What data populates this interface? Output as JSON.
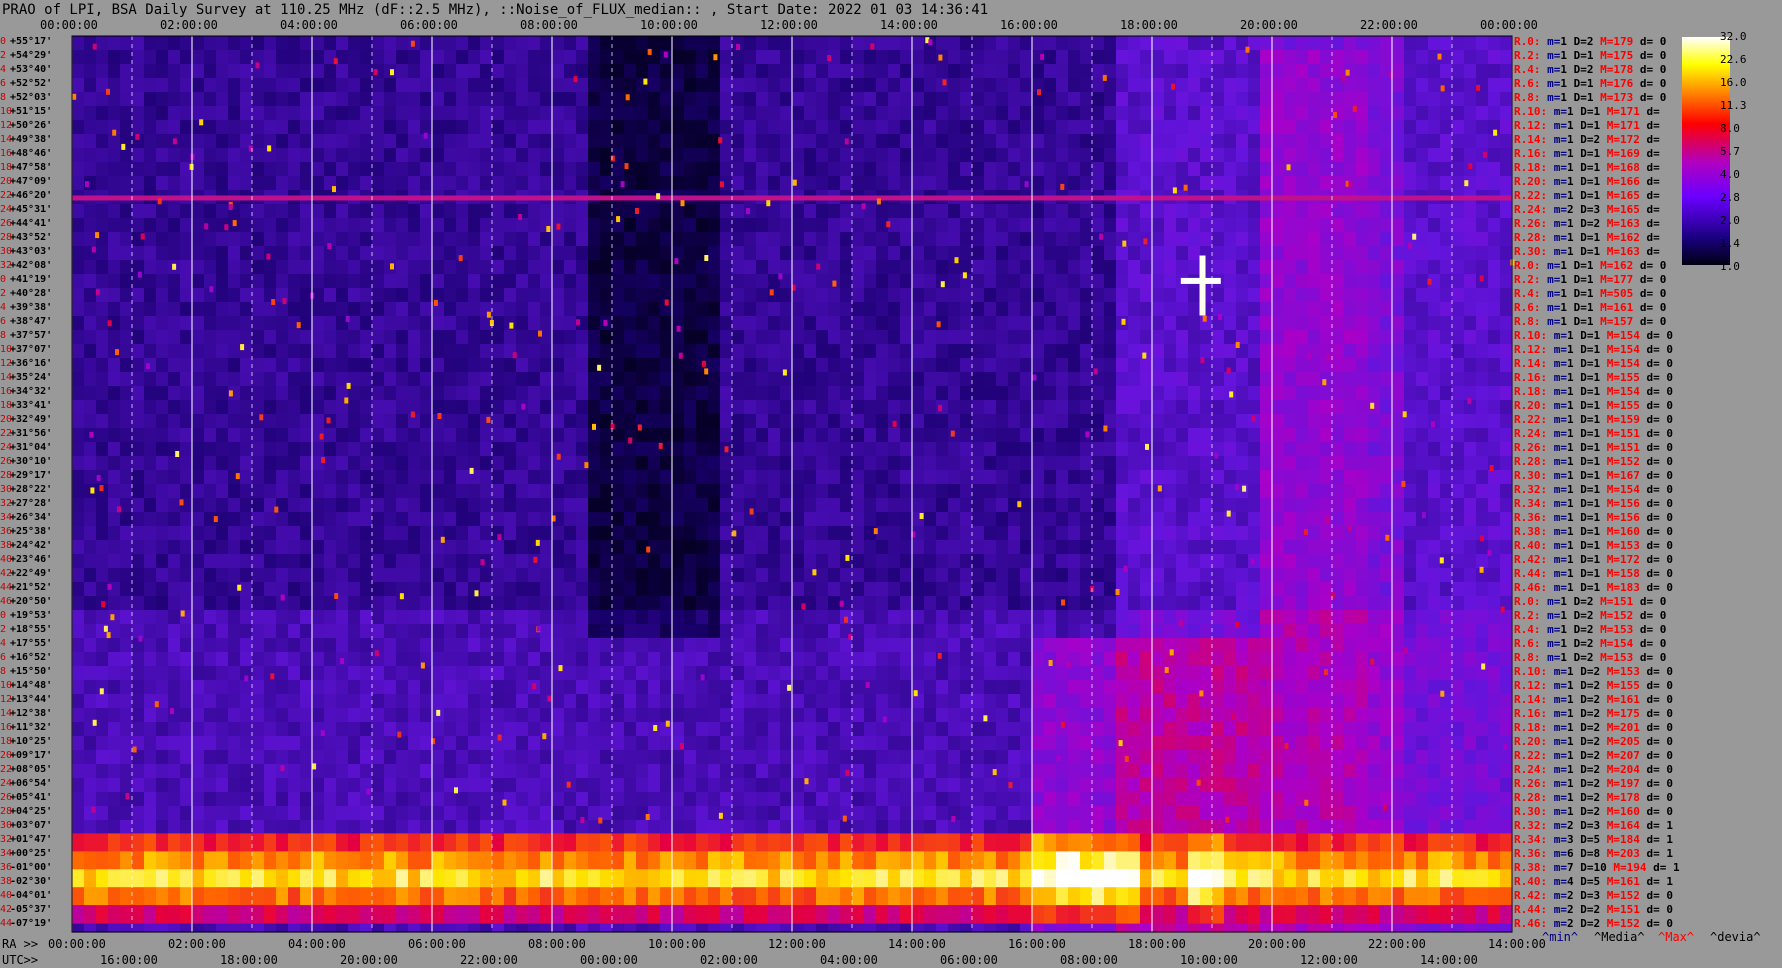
{
  "title": "PRAO of LPI, BSA Daily Survey at 110.25 MHz (dF::2.5 MHz), ::Noise_of_FLUX_median:: , Start Date: 2022 01 03 14:36:41",
  "chart_data": {
    "type": "heatmap",
    "title": "PRAO of LPI, BSA Daily Survey at 110.25 MHz (dF::2.5 MHz), ::Noise_of_FLUX_median:: , Start Date: 2022 01 03 14:36:41",
    "x_top_ticks": [
      "00:00:00",
      "02:00:00",
      "04:00:00",
      "06:00:00",
      "08:00:00",
      "10:00:00",
      "12:00:00",
      "14:00:00",
      "16:00:00",
      "18:00:00",
      "20:00:00",
      "22:00:00",
      "00:00:00"
    ],
    "x_bottom_ra_prefix": "RA >>",
    "x_bottom_ra_ticks": [
      "00:00:00",
      "02:00:00",
      "04:00:00",
      "06:00:00",
      "08:00:00",
      "10:00:00",
      "12:00:00",
      "14:00:00",
      "16:00:00",
      "18:00:00",
      "20:00:00",
      "22:00:00",
      "14:00:00"
    ],
    "x_bottom_utc_prefix": "UTC>>",
    "x_bottom_utc_ticks": [
      "16:00:00",
      "18:00:00",
      "20:00:00",
      "22:00:00",
      "00:00:00",
      "02:00:00",
      "04:00:00",
      "06:00:00",
      "08:00:00",
      "10:00:00",
      "12:00:00",
      "14:00:00"
    ],
    "y_labels": [
      {
        "i": "0",
        "d": "+55°17'"
      },
      {
        "i": "2",
        "d": "+54°29'"
      },
      {
        "i": "4",
        "d": "+53°40'"
      },
      {
        "i": "6",
        "d": "+52°52'"
      },
      {
        "i": "8",
        "d": "+52°03'"
      },
      {
        "i": "10",
        "d": "+51°15'"
      },
      {
        "i": "12",
        "d": "+50°26'"
      },
      {
        "i": "14",
        "d": "+49°38'"
      },
      {
        "i": "16",
        "d": "+48°46'"
      },
      {
        "i": "18",
        "d": "+47°58'"
      },
      {
        "i": "20",
        "d": "+47°09'"
      },
      {
        "i": "22",
        "d": "+46°20'"
      },
      {
        "i": "24",
        "d": "+45°31'"
      },
      {
        "i": "26",
        "d": "+44°41'"
      },
      {
        "i": "28",
        "d": "+43°52'"
      },
      {
        "i": "30",
        "d": "+43°03'"
      },
      {
        "i": "32",
        "d": "+42°08'"
      },
      {
        "i": "0",
        "d": "+41°19'"
      },
      {
        "i": "2",
        "d": "+40°28'"
      },
      {
        "i": "4",
        "d": "+39°38'"
      },
      {
        "i": "6",
        "d": "+38°47'"
      },
      {
        "i": "8",
        "d": "+37°57'"
      },
      {
        "i": "10",
        "d": "+37°07'"
      },
      {
        "i": "12",
        "d": "+36°16'"
      },
      {
        "i": "14",
        "d": "+35°24'"
      },
      {
        "i": "16",
        "d": "+34°32'"
      },
      {
        "i": "18",
        "d": "+33°41'"
      },
      {
        "i": "20",
        "d": "+32°49'"
      },
      {
        "i": "22",
        "d": "+31°56'"
      },
      {
        "i": "24",
        "d": "+31°04'"
      },
      {
        "i": "26",
        "d": "+30°10'"
      },
      {
        "i": "28",
        "d": "+29°17'"
      },
      {
        "i": "30",
        "d": "+28°22'"
      },
      {
        "i": "32",
        "d": "+27°28'"
      },
      {
        "i": "34",
        "d": "+26°34'"
      },
      {
        "i": "36",
        "d": "+25°38'"
      },
      {
        "i": "38",
        "d": "+24°42'"
      },
      {
        "i": "40",
        "d": "+23°46'"
      },
      {
        "i": "42",
        "d": "+22°49'"
      },
      {
        "i": "44",
        "d": "+21°52'"
      },
      {
        "i": "46",
        "d": "+20°50'"
      },
      {
        "i": "0",
        "d": "+19°53'"
      },
      {
        "i": "2",
        "d": "+18°55'"
      },
      {
        "i": "4",
        "d": "+17°55'"
      },
      {
        "i": "6",
        "d": "+16°52'"
      },
      {
        "i": "8",
        "d": "+15°50'"
      },
      {
        "i": "10",
        "d": "+14°48'"
      },
      {
        "i": "12",
        "d": "+13°44'"
      },
      {
        "i": "14",
        "d": "+12°38'"
      },
      {
        "i": "16",
        "d": "+11°32'"
      },
      {
        "i": "18",
        "d": "+10°25'"
      },
      {
        "i": "20",
        "d": "+09°17'"
      },
      {
        "i": "22",
        "d": "+08°05'"
      },
      {
        "i": "24",
        "d": "+06°54'"
      },
      {
        "i": "26",
        "d": "+05°41'"
      },
      {
        "i": "28",
        "d": "+04°25'"
      },
      {
        "i": "30",
        "d": "+03°07'"
      },
      {
        "i": "32",
        "d": "+01°47'"
      },
      {
        "i": "34",
        "d": "+00°25'"
      },
      {
        "i": "36",
        "d": "-01°00'"
      },
      {
        "i": "38",
        "d": "-02°30'"
      },
      {
        "i": "40",
        "d": "-04°01'"
      },
      {
        "i": "42",
        "d": "-05°37'"
      },
      {
        "i": "44",
        "d": "-07°19'"
      }
    ],
    "row_stats": [
      {
        "r": "R.0:",
        "m": "1",
        "D": "2",
        "M": "179",
        "d": "0"
      },
      {
        "r": "R.2:",
        "m": "1",
        "D": "1",
        "M": "175",
        "d": "0"
      },
      {
        "r": "R.4:",
        "m": "1",
        "D": "2",
        "M": "178",
        "d": "0"
      },
      {
        "r": "R.6:",
        "m": "1",
        "D": "1",
        "M": "176",
        "d": "0"
      },
      {
        "r": "R.8:",
        "m": "1",
        "D": "1",
        "M": "173",
        "d": "0"
      },
      {
        "r": "R.10:",
        "m": "1",
        "D": "1",
        "M": "171",
        "d": ""
      },
      {
        "r": "R.12:",
        "m": "1",
        "D": "1",
        "M": "171",
        "d": ""
      },
      {
        "r": "R.14:",
        "m": "1",
        "D": "2",
        "M": "172",
        "d": ""
      },
      {
        "r": "R.16:",
        "m": "1",
        "D": "1",
        "M": "169",
        "d": ""
      },
      {
        "r": "R.18:",
        "m": "1",
        "D": "1",
        "M": "168",
        "d": ""
      },
      {
        "r": "R.20:",
        "m": "1",
        "D": "1",
        "M": "166",
        "d": ""
      },
      {
        "r": "R.22:",
        "m": "1",
        "D": "1",
        "M": "165",
        "d": ""
      },
      {
        "r": "R.24:",
        "m": "2",
        "D": "3",
        "M": "165",
        "d": ""
      },
      {
        "r": "R.26:",
        "m": "1",
        "D": "2",
        "M": "163",
        "d": ""
      },
      {
        "r": "R.28:",
        "m": "1",
        "D": "1",
        "M": "162",
        "d": ""
      },
      {
        "r": "R.30:",
        "m": "1",
        "D": "1",
        "M": "163",
        "d": ""
      },
      {
        "r": "R.0:",
        "m": "1",
        "D": "1",
        "M": "162",
        "d": "0"
      },
      {
        "r": "R.2:",
        "m": "1",
        "D": "1",
        "M": "177",
        "d": "0"
      },
      {
        "r": "R.4:",
        "m": "1",
        "D": "1",
        "M": "505",
        "d": "0"
      },
      {
        "r": "R.6:",
        "m": "1",
        "D": "1",
        "M": "161",
        "d": "0"
      },
      {
        "r": "R.8:",
        "m": "1",
        "D": "1",
        "M": "157",
        "d": "0"
      },
      {
        "r": "R.10:",
        "m": "1",
        "D": "1",
        "M": "154",
        "d": "0"
      },
      {
        "r": "R.12:",
        "m": "1",
        "D": "1",
        "M": "154",
        "d": "0"
      },
      {
        "r": "R.14:",
        "m": "1",
        "D": "1",
        "M": "154",
        "d": "0"
      },
      {
        "r": "R.16:",
        "m": "1",
        "D": "1",
        "M": "155",
        "d": "0"
      },
      {
        "r": "R.18:",
        "m": "1",
        "D": "1",
        "M": "154",
        "d": "0"
      },
      {
        "r": "R.20:",
        "m": "1",
        "D": "1",
        "M": "155",
        "d": "0"
      },
      {
        "r": "R.22:",
        "m": "1",
        "D": "1",
        "M": "159",
        "d": "0"
      },
      {
        "r": "R.24:",
        "m": "1",
        "D": "1",
        "M": "151",
        "d": "0"
      },
      {
        "r": "R.26:",
        "m": "1",
        "D": "1",
        "M": "151",
        "d": "0"
      },
      {
        "r": "R.28:",
        "m": "1",
        "D": "1",
        "M": "152",
        "d": "0"
      },
      {
        "r": "R.30:",
        "m": "1",
        "D": "1",
        "M": "167",
        "d": "0"
      },
      {
        "r": "R.32:",
        "m": "1",
        "D": "1",
        "M": "154",
        "d": "0"
      },
      {
        "r": "R.34:",
        "m": "1",
        "D": "1",
        "M": "156",
        "d": "0"
      },
      {
        "r": "R.36:",
        "m": "1",
        "D": "1",
        "M": "156",
        "d": "0"
      },
      {
        "r": "R.38:",
        "m": "1",
        "D": "1",
        "M": "160",
        "d": "0"
      },
      {
        "r": "R.40:",
        "m": "1",
        "D": "1",
        "M": "153",
        "d": "0"
      },
      {
        "r": "R.42:",
        "m": "1",
        "D": "1",
        "M": "172",
        "d": "0"
      },
      {
        "r": "R.44:",
        "m": "1",
        "D": "1",
        "M": "158",
        "d": "0"
      },
      {
        "r": "R.46:",
        "m": "1",
        "D": "1",
        "M": "183",
        "d": "0"
      },
      {
        "r": "R.0:",
        "m": "1",
        "D": "2",
        "M": "151",
        "d": "0"
      },
      {
        "r": "R.2:",
        "m": "1",
        "D": "2",
        "M": "152",
        "d": "0"
      },
      {
        "r": "R.4:",
        "m": "1",
        "D": "2",
        "M": "153",
        "d": "0"
      },
      {
        "r": "R.6:",
        "m": "1",
        "D": "2",
        "M": "154",
        "d": "0"
      },
      {
        "r": "R.8:",
        "m": "1",
        "D": "2",
        "M": "153",
        "d": "0"
      },
      {
        "r": "R.10:",
        "m": "1",
        "D": "2",
        "M": "153",
        "d": "0"
      },
      {
        "r": "R.12:",
        "m": "1",
        "D": "2",
        "M": "155",
        "d": "0"
      },
      {
        "r": "R.14:",
        "m": "1",
        "D": "2",
        "M": "161",
        "d": "0"
      },
      {
        "r": "R.16:",
        "m": "1",
        "D": "2",
        "M": "175",
        "d": "0"
      },
      {
        "r": "R.18:",
        "m": "1",
        "D": "2",
        "M": "201",
        "d": "0"
      },
      {
        "r": "R.20:",
        "m": "1",
        "D": "2",
        "M": "205",
        "d": "0"
      },
      {
        "r": "R.22:",
        "m": "1",
        "D": "2",
        "M": "207",
        "d": "0"
      },
      {
        "r": "R.24:",
        "m": "1",
        "D": "2",
        "M": "204",
        "d": "0"
      },
      {
        "r": "R.26:",
        "m": "1",
        "D": "2",
        "M": "197",
        "d": "0"
      },
      {
        "r": "R.28:",
        "m": "1",
        "D": "2",
        "M": "178",
        "d": "0"
      },
      {
        "r": "R.30:",
        "m": "1",
        "D": "2",
        "M": "160",
        "d": "0"
      },
      {
        "r": "R.32:",
        "m": "2",
        "D": "3",
        "M": "164",
        "d": "1"
      },
      {
        "r": "R.34:",
        "m": "3",
        "D": "5",
        "M": "184",
        "d": "1"
      },
      {
        "r": "R.36:",
        "m": "6",
        "D": "8",
        "M": "203",
        "d": "1"
      },
      {
        "r": "R.38:",
        "m": "7",
        "D": "10",
        "M": "194",
        "d": "1"
      },
      {
        "r": "R.40:",
        "m": "4",
        "D": "5",
        "M": "161",
        "d": "1"
      },
      {
        "r": "R.42:",
        "m": "2",
        "D": "3",
        "M": "152",
        "d": "0"
      },
      {
        "r": "R.44:",
        "m": "2",
        "D": "2",
        "M": "151",
        "d": "0"
      },
      {
        "r": "R.46:",
        "m": "2",
        "D": "2",
        "M": "152",
        "d": "0"
      }
    ],
    "stat_keys": {
      "m": "m=",
      "D": "D=",
      "M": "M=",
      "d": "d="
    },
    "legend_footer": [
      "^min^",
      "^Media^",
      "^Max^",
      "^devia^"
    ],
    "colorbar_ticks": [
      "32.0",
      "22.6",
      "16.0",
      "11.3",
      "8.0",
      "5.7",
      "4.0",
      "2.8",
      "2.0",
      "1.4",
      "1.0"
    ],
    "colors": {
      "background": "#999999",
      "red_label": "#ff0000",
      "blue_label": "#000080"
    }
  }
}
